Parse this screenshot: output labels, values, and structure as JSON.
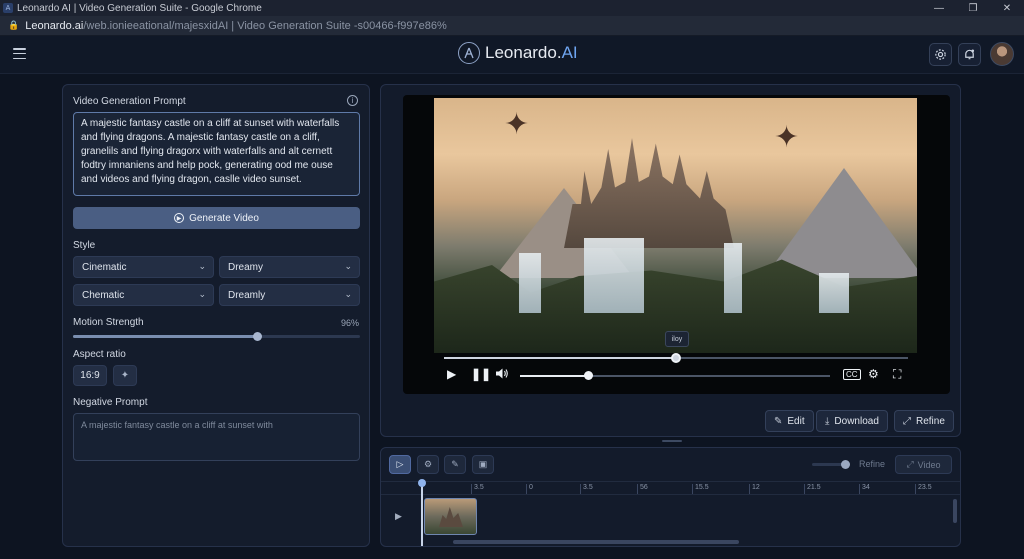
{
  "browser": {
    "window_title": "Leonardo AI | Video Generation Suite - Google Chrome",
    "url_host": "Leonardo.ai",
    "url_path": "/web.ionieeational/majesxidAI | Video Generation Suite -s00466-f997e86%"
  },
  "header": {
    "brand_main": "Leonardo.",
    "brand_accent": "AI"
  },
  "left_panel": {
    "prompt_label": "Video Generation Prompt",
    "prompt_text": "A majestic fantasy castle on a cliff at sunset with waterfalls and flying dragons. A majestic fantasy castle on a cliff, granelils and flying dragorx with waterfalls and alt cernett fodtry imnaniens and help pock, generating ood me ouse and videos and flying dragon, caslle video sunset.",
    "generate_button": "Generate Video",
    "style_label": "Style",
    "style_selects": [
      "Cinematic",
      "Dreamy",
      "Chematic",
      "Dreamly"
    ],
    "motion_label": "Motion Strength",
    "motion_value_text": "96%",
    "motion_value": 0.64,
    "aspect_label": "Aspect ratio",
    "aspect_value": "16:9",
    "negative_label": "Negative Prompt",
    "negative_placeholder": "A majestic fantasy castle on a cliff at sunset with"
  },
  "player": {
    "tooltip": "iloy",
    "progress": 0.5,
    "volume": 0.22
  },
  "actions": {
    "edit": "Edit",
    "download": "Download",
    "refine": "Refine"
  },
  "timeline": {
    "refine_label": "Refine",
    "video_button": "Video",
    "ruler": [
      "3.5",
      "0",
      "3.5",
      "56",
      "15.5",
      "12",
      "21.5",
      "34",
      "23.5"
    ]
  },
  "icons": {
    "menu": "hamburger-icon",
    "settings": "gear-icon",
    "notifications": "bell-icon",
    "info": "info-icon",
    "play": "play-icon",
    "pause": "pause-icon",
    "volume": "volume-icon",
    "captions": "captions-icon",
    "fullscreen": "fullscreen-icon"
  },
  "colors": {
    "accent": "#6fa5f0",
    "background": "#0d1421",
    "panel": "#141c2c"
  }
}
